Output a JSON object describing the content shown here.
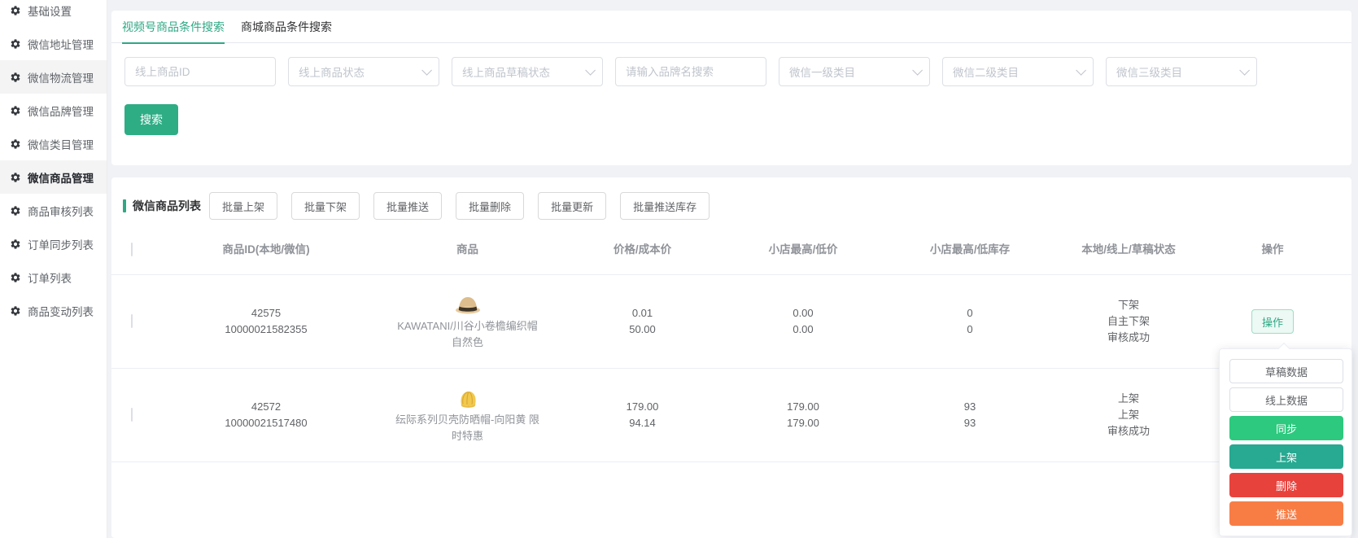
{
  "sidebar": {
    "items": [
      {
        "label": "基础设置"
      },
      {
        "label": "微信地址管理"
      },
      {
        "label": "微信物流管理"
      },
      {
        "label": "微信品牌管理"
      },
      {
        "label": "微信类目管理"
      },
      {
        "label": "微信商品管理"
      },
      {
        "label": "商品审核列表"
      },
      {
        "label": "订单同步列表"
      },
      {
        "label": "订单列表"
      },
      {
        "label": "商品变动列表"
      }
    ]
  },
  "tabs": [
    {
      "label": "视频号商品条件搜索"
    },
    {
      "label": "商城商品条件搜索"
    }
  ],
  "filters": [
    {
      "type": "input",
      "placeholder": "线上商品ID",
      "value": ""
    },
    {
      "type": "select",
      "placeholder": "线上商品状态"
    },
    {
      "type": "select",
      "placeholder": "线上商品草稿状态"
    },
    {
      "type": "input",
      "placeholder": "请输入品牌名搜索",
      "value": ""
    },
    {
      "type": "select",
      "placeholder": "微信一级类目"
    },
    {
      "type": "select",
      "placeholder": "微信二级类目"
    },
    {
      "type": "select",
      "placeholder": "微信三级类目"
    }
  ],
  "search_button": "搜索",
  "list": {
    "title": "微信商品列表",
    "batch_buttons": [
      "批量上架",
      "批量下架",
      "批量推送",
      "批量删除",
      "批量更新",
      "批量推送库存"
    ],
    "columns": [
      "商品ID(本地/微信)",
      "商品",
      "价格/成本价",
      "小店最高/低价",
      "小店最高/低库存",
      "本地/线上/草稿状态",
      "操作"
    ],
    "rows": [
      {
        "id_local": "42575",
        "id_wechat": "10000021582355",
        "name_lines": [
          "KAWATANI/川谷小卷檐编织帽",
          "自然色"
        ],
        "price": "0.01",
        "cost": "50.00",
        "shop_high": "0.00",
        "shop_low": "0.00",
        "stock_high": "0",
        "stock_low": "0",
        "status_local": "下架",
        "status_online": "自主下架",
        "status_draft": "审核成功",
        "action": "操作"
      },
      {
        "id_local": "42572",
        "id_wechat": "10000021517480",
        "name_lines": [
          "纭际系列贝壳防晒帽-向阳黄 限",
          "时特惠"
        ],
        "price": "179.00",
        "cost": "94.14",
        "shop_high": "179.00",
        "shop_low": "179.00",
        "stock_high": "93",
        "stock_low": "93",
        "status_local": "上架",
        "status_online": "上架",
        "status_draft": "审核成功",
        "action": "操作"
      }
    ]
  },
  "dropdown": {
    "items": [
      {
        "label": "草稿数据"
      },
      {
        "label": "线上数据"
      },
      {
        "label": "同步"
      },
      {
        "label": "上架"
      },
      {
        "label": "删除"
      },
      {
        "label": "推送"
      }
    ]
  },
  "colors": {
    "accent_green": "#2FA884",
    "search_button_green": "#2EAD85",
    "sync_green": "#2DC97E",
    "onshelf_teal": "#28A991",
    "delete_red": "#E8423D",
    "push_orange": "#F87D45",
    "text": "#606266",
    "text_muted": "#909399",
    "border": "#DCDFE6"
  }
}
